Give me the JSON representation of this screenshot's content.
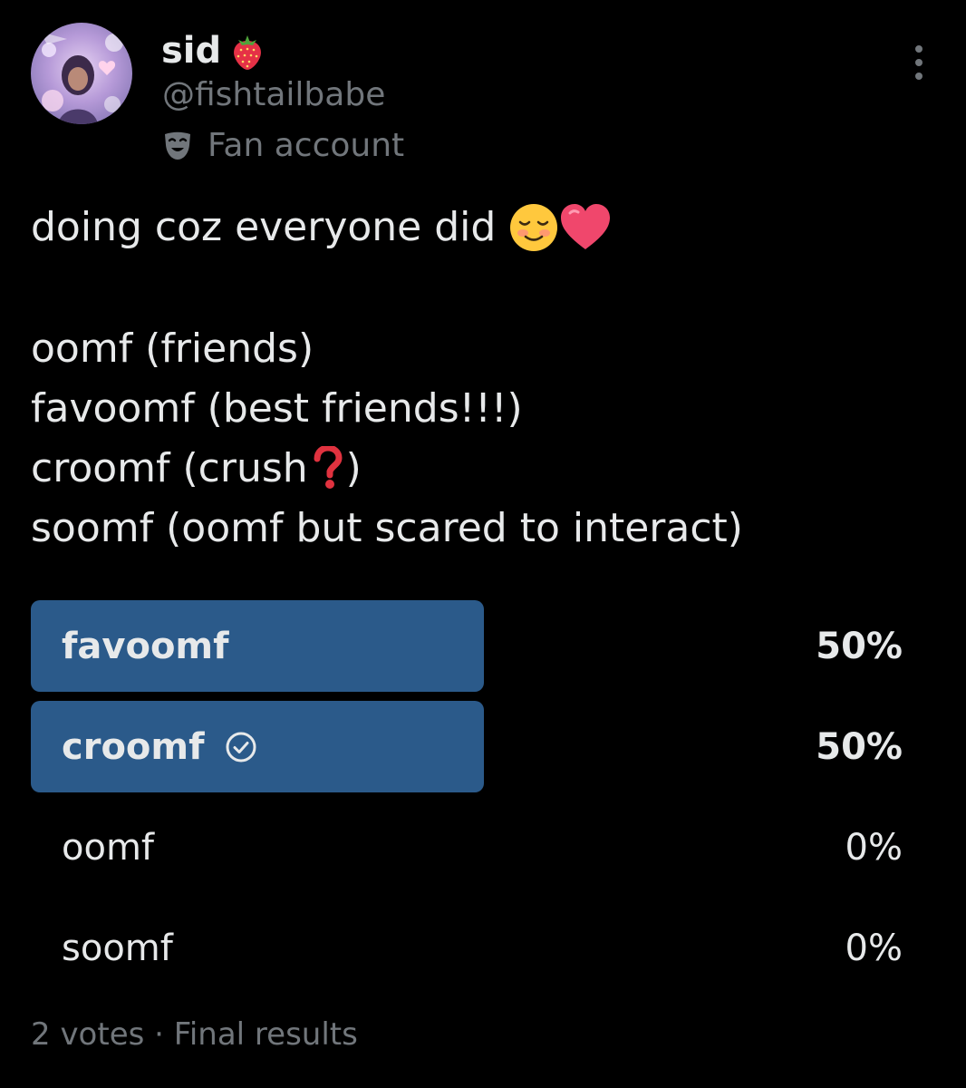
{
  "user": {
    "display_name": "sid",
    "name_emoji": "strawberry",
    "handle": "@fishtailbabe",
    "label_icon": "performing-arts-mask-icon",
    "label": "Fan account"
  },
  "tweet": {
    "line1": "doing coz everyone did",
    "line1_emojis": [
      "smiling-face-emoji",
      "heart-emoji"
    ],
    "line2": "oomf (friends)",
    "line3": "favoomf (best friends!!!)",
    "line4_before": "croomf (crush",
    "line4_emoji": "question-mark-emoji",
    "line4_after": ")",
    "line5": "soomf (oomf but scared to interact)"
  },
  "poll": {
    "options": [
      {
        "label": "favoomf",
        "percent": "50%",
        "fill_fraction": 0.5,
        "leader": true,
        "voted": false
      },
      {
        "label": "croomf",
        "percent": "50%",
        "fill_fraction": 0.5,
        "leader": true,
        "voted": true
      },
      {
        "label": "oomf",
        "percent": "0%",
        "fill_fraction": 0,
        "leader": false,
        "voted": false
      },
      {
        "label": "soomf",
        "percent": "0%",
        "fill_fraction": 0,
        "leader": false,
        "voted": false
      }
    ],
    "votes": "2 votes",
    "separator": "·",
    "status": "Final results"
  },
  "colors": {
    "background": "#000000",
    "text_primary": "#e7e9ea",
    "text_secondary": "#71767b",
    "poll_fill": "#2b5a8a"
  }
}
